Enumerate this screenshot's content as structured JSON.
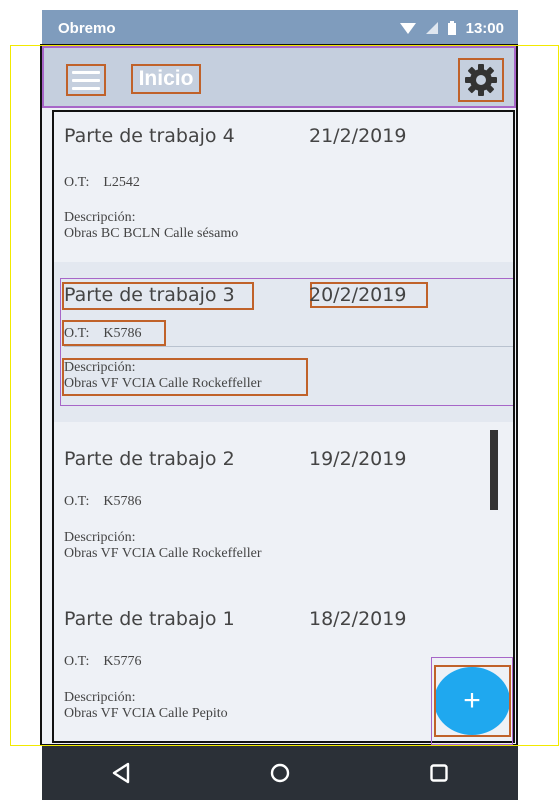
{
  "status_bar": {
    "carrier": "Obremo",
    "time": "13:00"
  },
  "app_bar": {
    "title": "Inicio",
    "menu_icon": "hamburger-icon",
    "settings_icon": "gear-icon"
  },
  "list": {
    "items": [
      {
        "title": "Parte de trabajo 4",
        "date": "21/2/2019",
        "ot_label": "O.T:",
        "ot_value": "L2542",
        "desc_label": "Descripción:",
        "desc": "Obras BC BCLN Calle sésamo"
      },
      {
        "title": "Parte de trabajo 3",
        "date": "20/2/2019",
        "ot_label": "O.T:",
        "ot_value": "K5786",
        "desc_label": "Descripción:",
        "desc": "Obras VF VCIA Calle Rockeffeller"
      },
      {
        "title": "Parte de trabajo 2",
        "date": "19/2/2019",
        "ot_label": "O.T:",
        "ot_value": "K5786",
        "desc_label": "Descripción:",
        "desc": "Obras VF VCIA Calle Rockeffeller"
      },
      {
        "title": "Parte de trabajo 1",
        "date": "18/2/2019",
        "ot_label": "O.T:",
        "ot_value": "K5776",
        "desc_label": "Descripción:",
        "desc": "Obras VF VCIA  Calle Pepito"
      }
    ]
  },
  "fab": {
    "label": "+",
    "icon": "plus-icon",
    "color": "#1fa8ef"
  },
  "nav": {
    "back_icon": "back-triangle-icon",
    "home_icon": "home-circle-icon",
    "recents_icon": "recents-square-icon"
  },
  "colors": {
    "status_bar": "#7f9cbd",
    "app_bar": "#c5cfde",
    "list_background": "#eef1f6",
    "selected_item": "#e3e8f0",
    "nav_bar": "#2b3037"
  }
}
